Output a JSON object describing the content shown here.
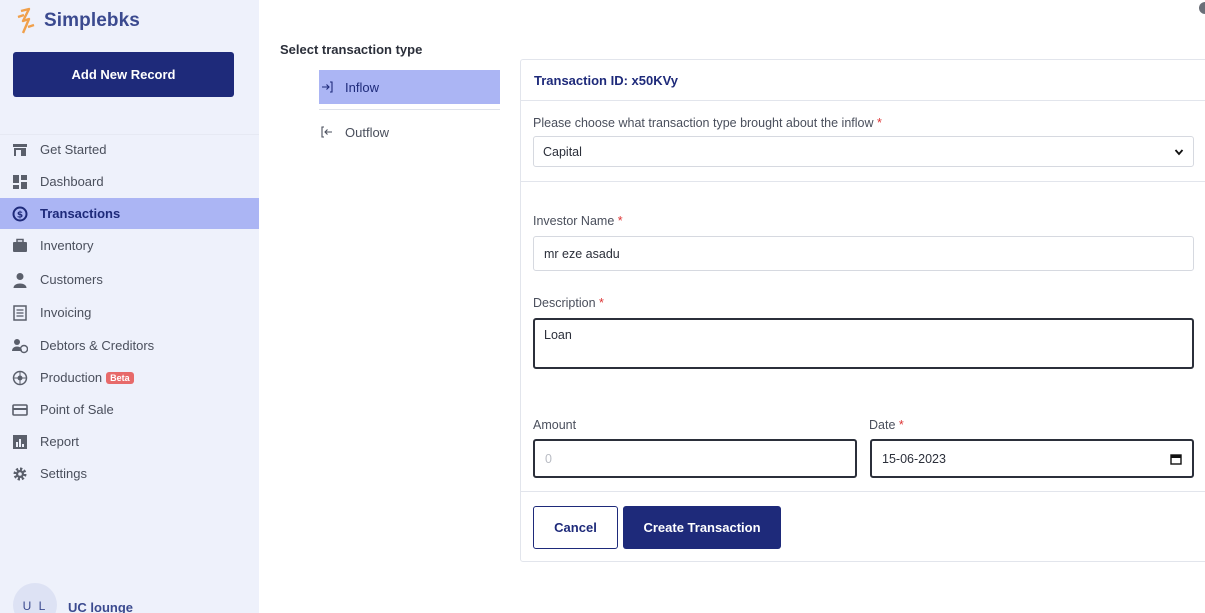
{
  "brand": {
    "name": "Simplebks"
  },
  "sidebar": {
    "add_button": "Add New Record",
    "items": [
      {
        "label": "Get Started",
        "icon": "storefront-icon"
      },
      {
        "label": "Dashboard",
        "icon": "dashboard-icon"
      },
      {
        "label": "Transactions",
        "icon": "currency-exchange-icon",
        "active": true
      },
      {
        "label": "Inventory",
        "icon": "briefcase-icon"
      },
      {
        "label": "Customers",
        "icon": "person-icon"
      },
      {
        "label": "Invoicing",
        "icon": "receipt-icon"
      },
      {
        "label": "Debtors & Creditors",
        "icon": "people-money-icon"
      },
      {
        "label": "Production",
        "icon": "factory-icon",
        "badge": "Beta"
      },
      {
        "label": "Point of Sale",
        "icon": "card-icon"
      },
      {
        "label": "Report",
        "icon": "bar-chart-icon"
      },
      {
        "label": "Settings",
        "icon": "gear-icon"
      }
    ],
    "user": {
      "initials": "U L",
      "name": "UC lounge"
    }
  },
  "main": {
    "section_title": "Select transaction type",
    "types": [
      {
        "label": "Inflow",
        "icon": "login-arrow-icon",
        "active": true
      },
      {
        "label": "Outflow",
        "icon": "logout-arrow-icon"
      }
    ],
    "panel": {
      "transaction_id": "Transaction ID: x50KVy",
      "type_question": "Please choose what transaction type brought about the inflow",
      "type_value": "Capital",
      "investor_label": "Investor Name",
      "investor_value": "mr eze asadu",
      "description_label": "Description",
      "description_value": "Loan",
      "amount_label": "Amount",
      "amount_placeholder": "0",
      "date_label": "Date",
      "date_value": "15-06-2023",
      "required_mark": "*",
      "cancel_button": "Cancel",
      "create_button": "Create Transaction"
    }
  },
  "colors": {
    "primary": "#1e2a7a",
    "active_bg": "#abb5f4",
    "sidebar_bg": "#eef1fb",
    "required": "#dd3333",
    "beta": "#e76a6a"
  }
}
